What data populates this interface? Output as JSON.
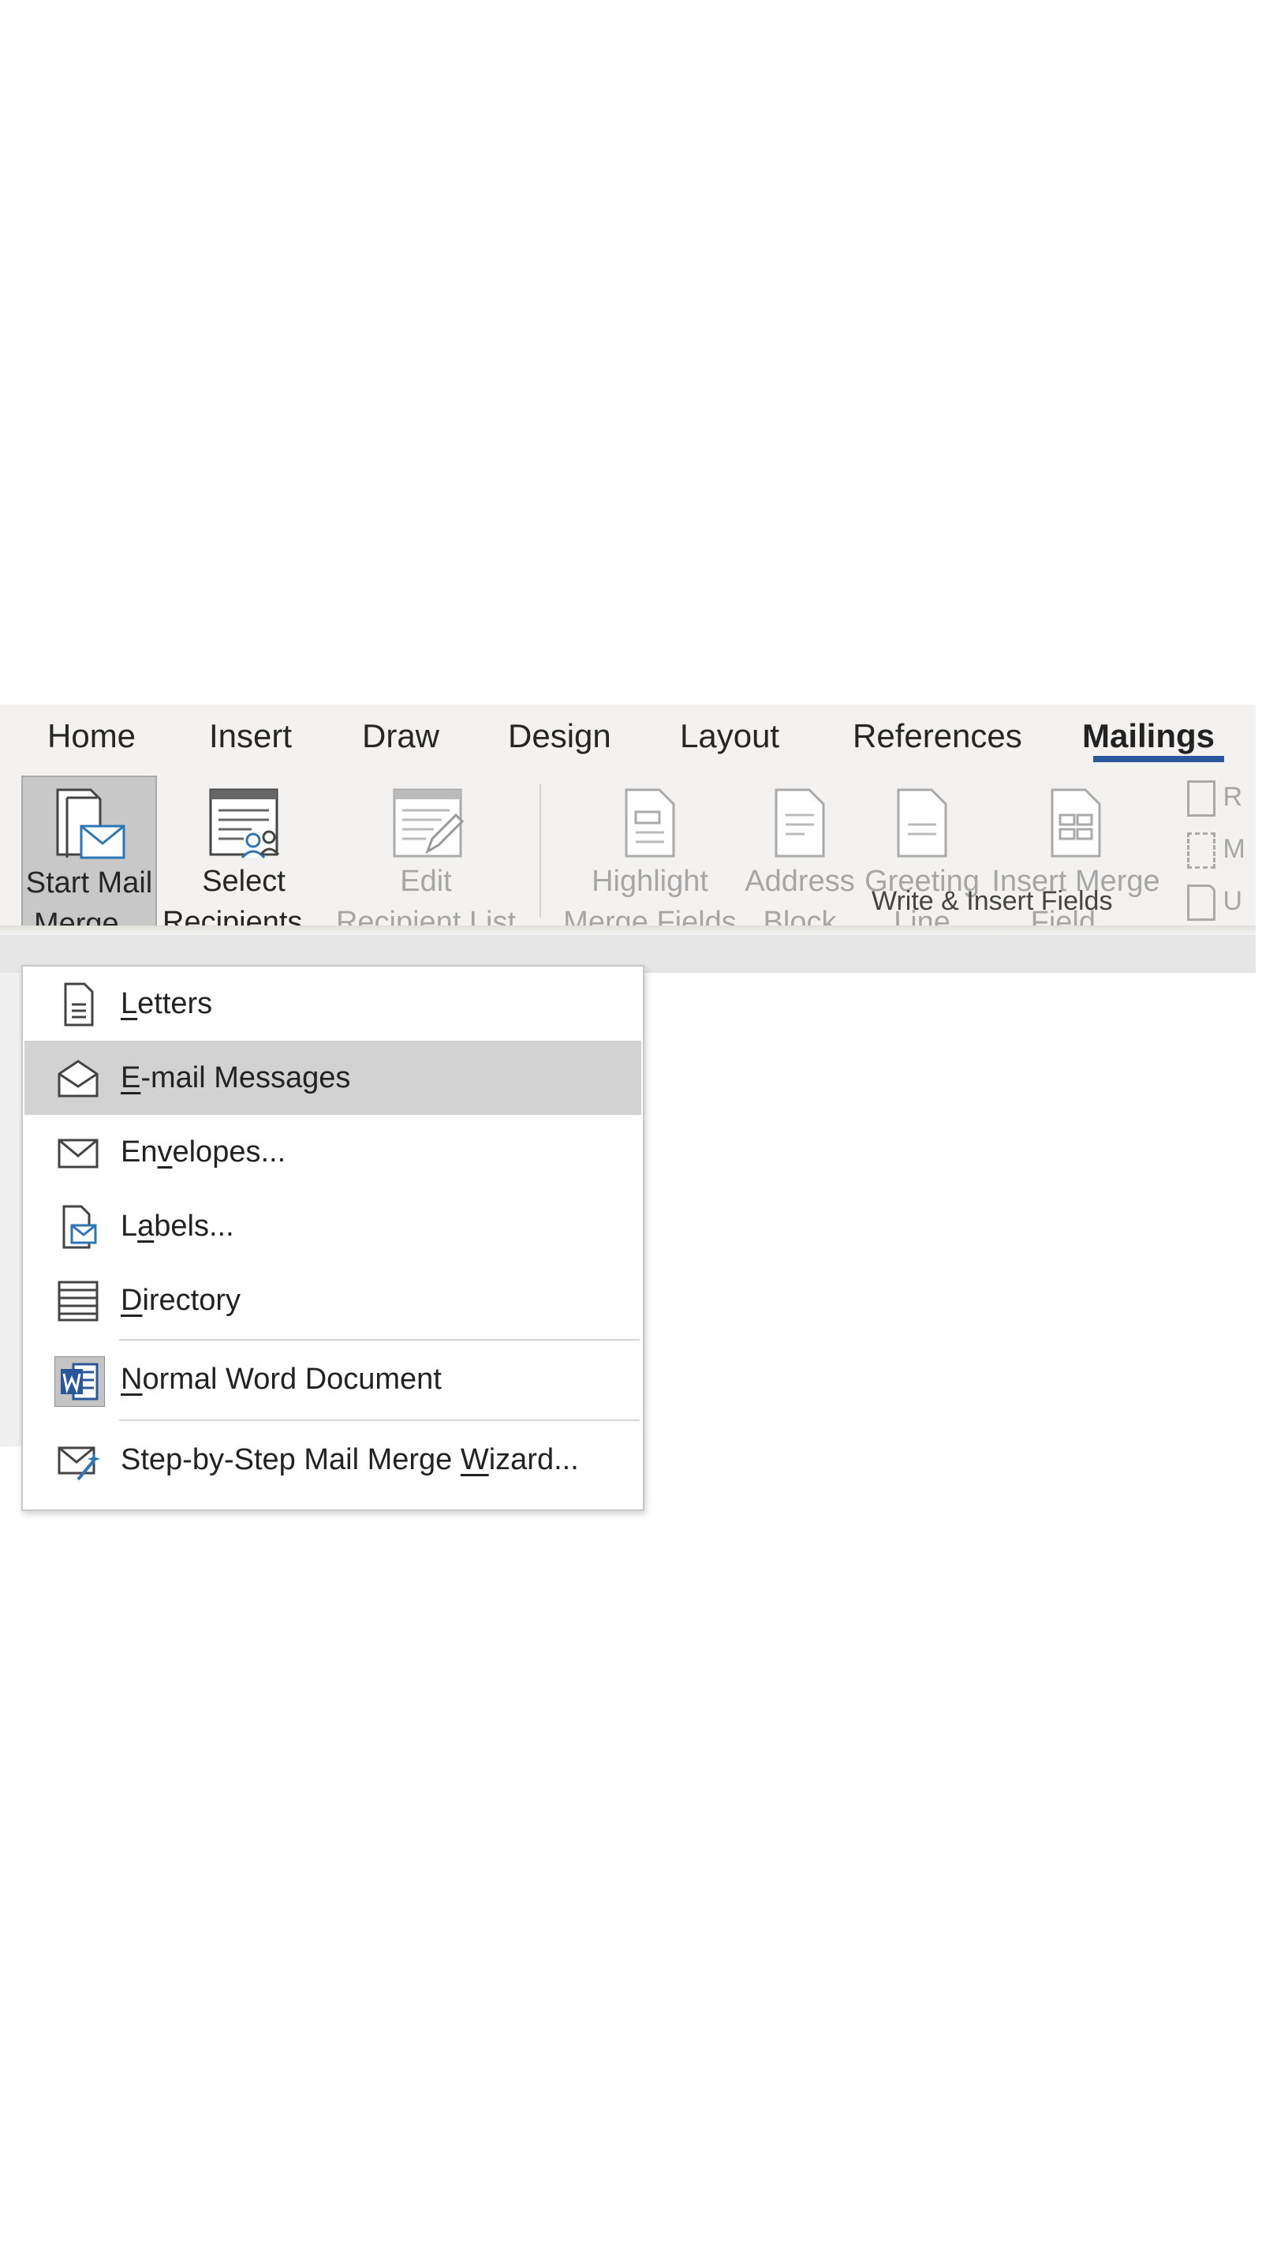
{
  "tabs": [
    {
      "label": "Home"
    },
    {
      "label": "Insert"
    },
    {
      "label": "Draw"
    },
    {
      "label": "Design"
    },
    {
      "label": "Layout"
    },
    {
      "label": "References"
    },
    {
      "label": "Mailings",
      "active": true
    }
  ],
  "ribbon": {
    "start_mail_merge": {
      "line1": "Start Mail",
      "line2": "Merge",
      "icon": "mail-merge-icon"
    },
    "select_recipients": {
      "line1": "Select",
      "line2": "Recipients",
      "icon": "recipients-icon"
    },
    "edit_recipient_list": {
      "line1": "Edit",
      "line2": "Recipient List",
      "icon": "edit-list-icon"
    },
    "highlight_merge_fields": {
      "line1": "Highlight",
      "line2": "Merge Fields"
    },
    "address_block": {
      "line1": "Address",
      "line2": "Block"
    },
    "greeting_line": {
      "line1": "Greeting",
      "line2": "Line"
    },
    "insert_merge_field": {
      "line1": "Insert Merge",
      "line2": "Field"
    },
    "group_label": "Write & Insert Fields",
    "small_buttons": [
      {
        "label": "R",
        "icon": "rules-icon"
      },
      {
        "label": "M",
        "icon": "match-fields-icon"
      },
      {
        "label": "U",
        "icon": "update-labels-icon"
      }
    ]
  },
  "menu": {
    "items": [
      {
        "pre": "",
        "key": "L",
        "post": "etters",
        "icon": "letters-icon"
      },
      {
        "pre": "",
        "key": "E",
        "post": "-mail Messages",
        "icon": "email-icon",
        "highlighted": true
      },
      {
        "pre": "En",
        "key": "v",
        "post": "elopes...",
        "icon": "envelope-icon"
      },
      {
        "pre": "L",
        "key": "a",
        "post": "bels...",
        "icon": "labels-icon"
      },
      {
        "pre": "",
        "key": "D",
        "post": "irectory",
        "icon": "directory-icon"
      },
      {
        "pre": "",
        "key": "N",
        "post": "ormal Word Document",
        "icon": "word-icon"
      },
      {
        "pre": "Step-by-Step Mail Merge ",
        "key": "W",
        "post": "izard...",
        "icon": "wizard-icon"
      }
    ]
  },
  "colors": {
    "accent": "#2b579a",
    "ribbon_bg": "#f3f2f1",
    "menu_highlight": "#d2d2d2",
    "icon_blue": "#2e75b6"
  }
}
